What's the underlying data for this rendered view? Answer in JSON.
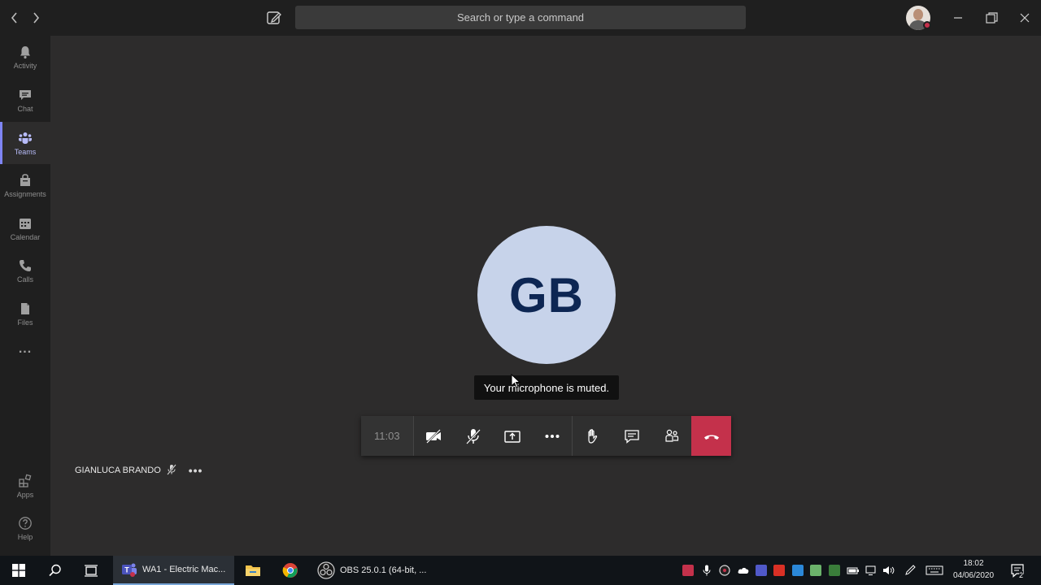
{
  "titlebar": {
    "search_placeholder": "Search or type a command"
  },
  "rail": {
    "items": [
      {
        "label": "Activity",
        "icon": "bell-icon"
      },
      {
        "label": "Chat",
        "icon": "chat-icon"
      },
      {
        "label": "Teams",
        "icon": "teams-icon",
        "active": true
      },
      {
        "label": "Assignments",
        "icon": "assignments-icon"
      },
      {
        "label": "Calendar",
        "icon": "calendar-icon"
      },
      {
        "label": "Calls",
        "icon": "phone-icon"
      },
      {
        "label": "Files",
        "icon": "file-icon"
      }
    ],
    "more": "...",
    "bottom": [
      {
        "label": "Apps",
        "icon": "apps-icon"
      },
      {
        "label": "Help",
        "icon": "help-icon"
      }
    ]
  },
  "call": {
    "avatar_initials": "GB",
    "tooltip": "Your microphone is muted.",
    "timer": "11:03",
    "participant_name": "GIANLUCA BRANDO",
    "participant_more": "•••"
  },
  "taskbar": {
    "teams_window": "WA1 - Electric Mac...",
    "obs_window": "OBS 25.0.1 (64-bit, ...",
    "time": "18:02",
    "date": "04/06/2020",
    "notification_count": "2"
  },
  "colors": {
    "accent": "#7f85f5",
    "hangup": "#c4314b",
    "avatar_bg": "#c7d3ea",
    "avatar_text": "#0d2653"
  }
}
